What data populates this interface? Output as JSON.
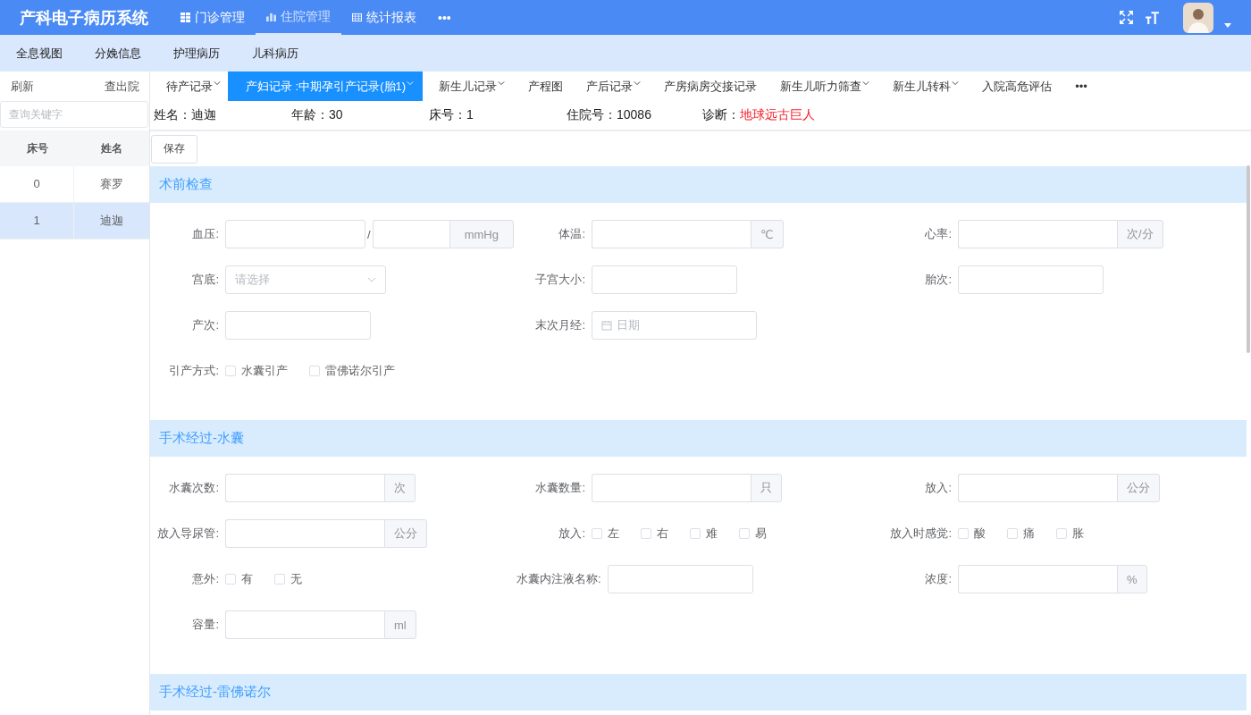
{
  "app": {
    "title": "产科电子病历系统"
  },
  "nav": [
    {
      "label": "门诊管理",
      "kind": "grid",
      "selected": false
    },
    {
      "label": "住院管理",
      "kind": "chart",
      "selected": true
    },
    {
      "label": "统计报表",
      "kind": "table",
      "selected": false
    },
    {
      "label": "•••",
      "kind": "more",
      "selected": false
    }
  ],
  "subnav": [
    "全息视图",
    "分娩信息",
    "护理病历",
    "儿科病历"
  ],
  "sidebar": {
    "actions": [
      "刷新",
      "查出院"
    ],
    "search": {
      "placeholder": "查询关键字"
    },
    "columns": [
      "床号",
      "姓名"
    ],
    "rows": [
      {
        "bed": "0",
        "name": "赛罗",
        "selected": false
      },
      {
        "bed": "1",
        "name": "迪迦",
        "selected": true
      }
    ]
  },
  "record_tabs": [
    {
      "label": "待产记录",
      "dropdown": true,
      "selected": false
    },
    {
      "label": "产妇记录 :中期孕引产记录(胎1)",
      "dropdown": true,
      "selected": true
    },
    {
      "label": "新生儿记录",
      "dropdown": true,
      "selected": false
    },
    {
      "label": "产程图",
      "dropdown": false,
      "selected": false
    },
    {
      "label": "产后记录",
      "dropdown": true,
      "selected": false
    },
    {
      "label": "产房病房交接记录",
      "dropdown": false,
      "selected": false
    },
    {
      "label": "新生儿听力筛查",
      "dropdown": true,
      "selected": false
    },
    {
      "label": "新生儿转科",
      "dropdown": true,
      "selected": false
    },
    {
      "label": "入院高危评估",
      "dropdown": false,
      "selected": false
    },
    {
      "label": "•••",
      "dropdown": false,
      "selected": false
    }
  ],
  "patient": [
    {
      "label": "姓名：",
      "value": "迪迦",
      "alert": false
    },
    {
      "label": "年龄：",
      "value": "30",
      "alert": false
    },
    {
      "label": "床号：",
      "value": "1",
      "alert": false
    },
    {
      "label": "住院号：",
      "value": "10086",
      "alert": false
    },
    {
      "label": "诊断：",
      "value": "地球远古巨人",
      "alert": true
    }
  ],
  "save_button": "保存",
  "sections": [
    {
      "title": "术前检查",
      "rows": [
        [
          {
            "label": "血压:",
            "kind": "pair",
            "separator": "/",
            "suffix": "mmHg"
          },
          {
            "label": "体温:",
            "kind": "input",
            "suffix": "℃"
          },
          {
            "label": "心率:",
            "kind": "input",
            "suffix": "次/分"
          }
        ],
        [
          {
            "label": "宫底:",
            "kind": "select",
            "placeholder": "请选择"
          },
          {
            "label": "子宫大小:",
            "kind": "input"
          },
          {
            "label": "胎次:",
            "kind": "input"
          }
        ],
        [
          {
            "label": "产次:",
            "kind": "input"
          },
          {
            "label": "末次月经:",
            "kind": "date",
            "placeholder": "日期"
          },
          null
        ],
        [
          {
            "label": "引产方式:",
            "kind": "checks",
            "options": [
              {
                "label": "水囊引产",
                "checked": false
              },
              {
                "label": "雷佛诺尔引产",
                "checked": false
              }
            ]
          },
          null,
          null
        ]
      ]
    },
    {
      "title": "手术经过-水囊",
      "rows": [
        [
          {
            "label": "水囊次数:",
            "kind": "input",
            "suffix": "次"
          },
          {
            "label": "水囊数量:",
            "kind": "input",
            "suffix": "只"
          },
          {
            "label": "放入:",
            "kind": "input",
            "suffix": "公分"
          }
        ],
        [
          {
            "label": "放入导尿管:",
            "kind": "input",
            "suffix": "公分"
          },
          {
            "label": "放入:",
            "kind": "checks",
            "options": [
              {
                "label": "左",
                "checked": false
              },
              {
                "label": "右",
                "checked": false
              },
              {
                "label": "难",
                "checked": false
              },
              {
                "label": "易",
                "checked": false
              }
            ]
          },
          {
            "label": "放入时感觉:",
            "kind": "checks",
            "options": [
              {
                "label": "酸",
                "checked": false
              },
              {
                "label": "痛",
                "checked": false
              },
              {
                "label": "胀",
                "checked": false
              }
            ]
          }
        ],
        [
          {
            "label": "意外:",
            "kind": "checks",
            "options": [
              {
                "label": "有",
                "checked": false
              },
              {
                "label": "无",
                "checked": false
              }
            ]
          },
          {
            "label": "水囊内注液名称:",
            "kind": "input"
          },
          {
            "label": "浓度:",
            "kind": "input",
            "suffix": "%"
          }
        ],
        [
          {
            "label": "容量:",
            "kind": "input",
            "suffix": "ml"
          },
          null,
          null
        ]
      ]
    },
    {
      "title": "手术经过-雷佛诺尔"
    }
  ]
}
